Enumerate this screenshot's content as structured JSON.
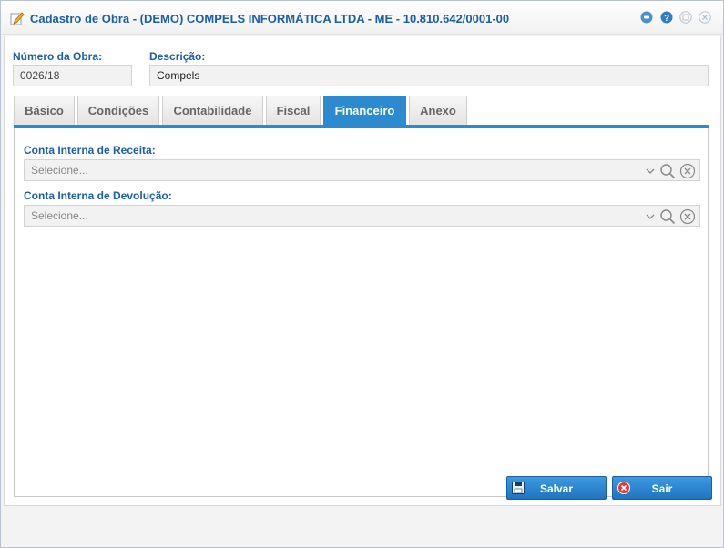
{
  "window": {
    "title": "Cadastro de Obra - (DEMO) COMPELS INFORMÁTICA LTDA - ME - 10.810.642/0001-00",
    "icon": "edit-pencil-icon"
  },
  "titlebar_buttons": [
    "minimize-icon",
    "help-icon",
    "restore-icon",
    "close-icon"
  ],
  "header": {
    "numero_label": "Número da Obra:",
    "numero_value": "0026/18",
    "descricao_label": "Descrição:",
    "descricao_value": "Compels"
  },
  "tabs": [
    {
      "label": "Básico",
      "active": false
    },
    {
      "label": "Condições",
      "active": false
    },
    {
      "label": "Contabilidade",
      "active": false
    },
    {
      "label": "Fiscal",
      "active": false
    },
    {
      "label": "Financeiro",
      "active": true
    },
    {
      "label": "Anexo",
      "active": false
    }
  ],
  "financeiro": {
    "conta_receita_label": "Conta Interna de Receita:",
    "conta_receita_placeholder": "Selecione...",
    "conta_devolucao_label": "Conta Interna de Devolução:",
    "conta_devolucao_placeholder": "Selecione..."
  },
  "footer": {
    "save_label": "Salvar",
    "exit_label": "Sair"
  },
  "colors": {
    "accent": "#2c8bd0",
    "title": "#1a5fa8"
  }
}
